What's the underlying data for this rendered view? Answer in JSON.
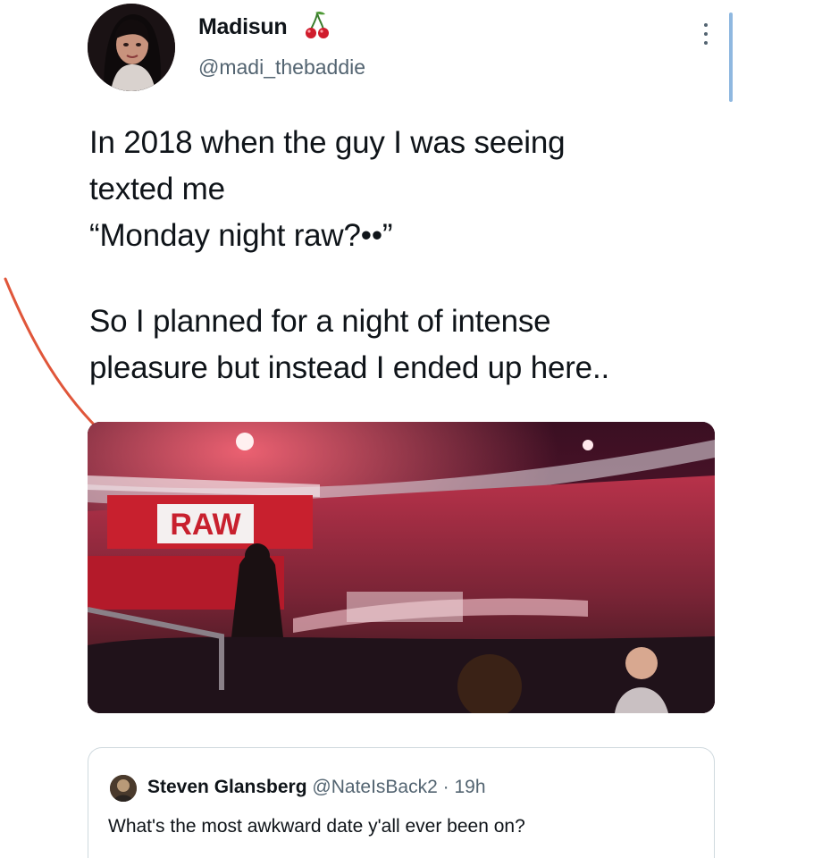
{
  "author": {
    "display_name": "Madisun",
    "name_emoji": "cherry-icon",
    "handle": "@madi_thebaddie"
  },
  "tweet": {
    "lines": [
      "In 2018 when the guy I was seeing",
      "texted me",
      "“Monday night raw?••”",
      "So I planned for a night of intense",
      "pleasure but instead I ended up here.."
    ]
  },
  "media": {
    "sign_text": "RAW"
  },
  "quoted_tweet": {
    "name": "Steven Glansberg",
    "handle": "@NateIsBack2",
    "separator": "·",
    "time": "19h",
    "text": "What's the most awkward date y'all ever been on?"
  },
  "colors": {
    "text": "#0f1419",
    "secondary_text": "#536471",
    "border": "#cfd9de",
    "annotation": "#e0563a",
    "scroll_indicator": "#8fb8e0"
  }
}
